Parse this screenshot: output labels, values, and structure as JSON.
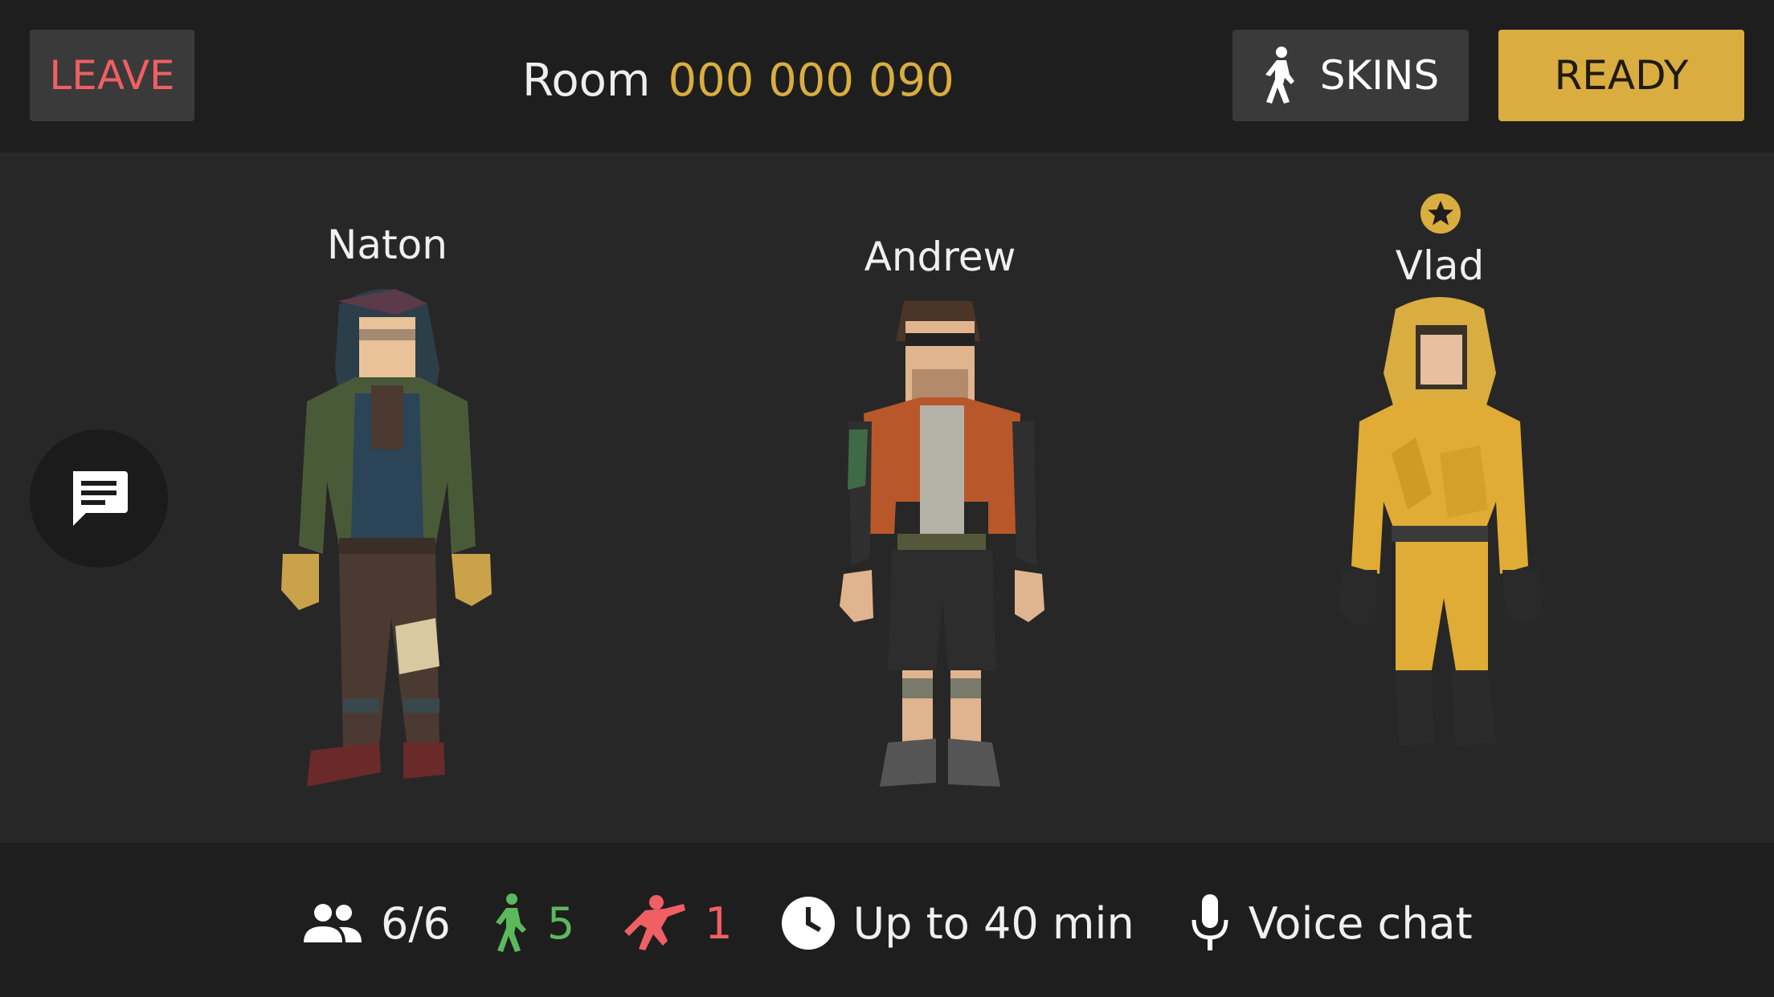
{
  "header": {
    "leave_label": "LEAVE",
    "room_label": "Room",
    "room_code": "000 000 090",
    "skins_label": "SKINS",
    "ready_label": "READY"
  },
  "players": [
    {
      "name": "Naton",
      "host": false
    },
    {
      "name": "Andrew",
      "host": false
    },
    {
      "name": "Vlad",
      "host": true
    }
  ],
  "footer": {
    "players_count": "6/6",
    "survivors_count": "5",
    "hunters_count": "1",
    "duration": "Up to 40 min",
    "voice": "Voice chat"
  },
  "colors": {
    "accent": "#d9ad3f",
    "leave": "#ef5f63",
    "survivor": "#5cb85c",
    "hunter": "#ef5f63"
  },
  "icons": [
    "walking-person-icon",
    "chat-icon",
    "host-star-icon",
    "people-icon",
    "survivor-icon",
    "hunter-icon",
    "clock-icon",
    "microphone-icon"
  ]
}
